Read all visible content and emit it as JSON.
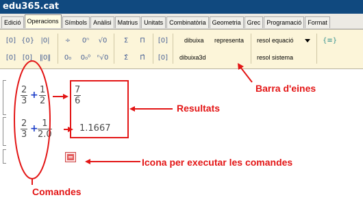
{
  "app": {
    "title": "edu365.cat"
  },
  "tabs": [
    "Edició",
    "Operacions",
    "Símbols",
    "Anàlisi",
    "Matrius",
    "Unitats",
    "Combinatòria",
    "Geometria",
    "Grec",
    "Programació",
    "Format"
  ],
  "active_tab": "Operacions",
  "toolbar": {
    "icons": [
      "paren-pair-icon",
      "brace-pair-icon",
      "abs-value-icon",
      "fraction-icon",
      "power-icon",
      "sqrt-icon",
      "sum-icon",
      "product-icon",
      "bracket-icon",
      "matrix-icon",
      "subscript-icon",
      "nth-root-icon",
      "sum-limits-icon",
      "product-limits-icon",
      "bracket-alt-icon",
      "equation-system-icon"
    ],
    "dibuixa": "dibuixa",
    "representa": "representa",
    "dibuixa3d": "dibuixa3d",
    "resol_equacio": "resol equació",
    "resol_sistema": "resol sistema"
  },
  "expressions": [
    {
      "a_num": "2",
      "a_den": "3",
      "op": "+",
      "b_num": "1",
      "b_den": "2",
      "result_num": "7",
      "result_den": "6"
    },
    {
      "a_num": "2",
      "a_den": "3",
      "op": "+",
      "b_num": "1",
      "b_den": "2.0",
      "result": "1.1667"
    }
  ],
  "annotations": {
    "toolbar": "Barra d'eines",
    "results": "Resultats",
    "execute_icon": "Icona per executar les comandes",
    "commands": "Comandes"
  },
  "colors": {
    "title_bar": "#10497f",
    "toolbar_bg": "#fcf5d9",
    "annotation": "#e31515",
    "operator": "#1a3cc8"
  }
}
